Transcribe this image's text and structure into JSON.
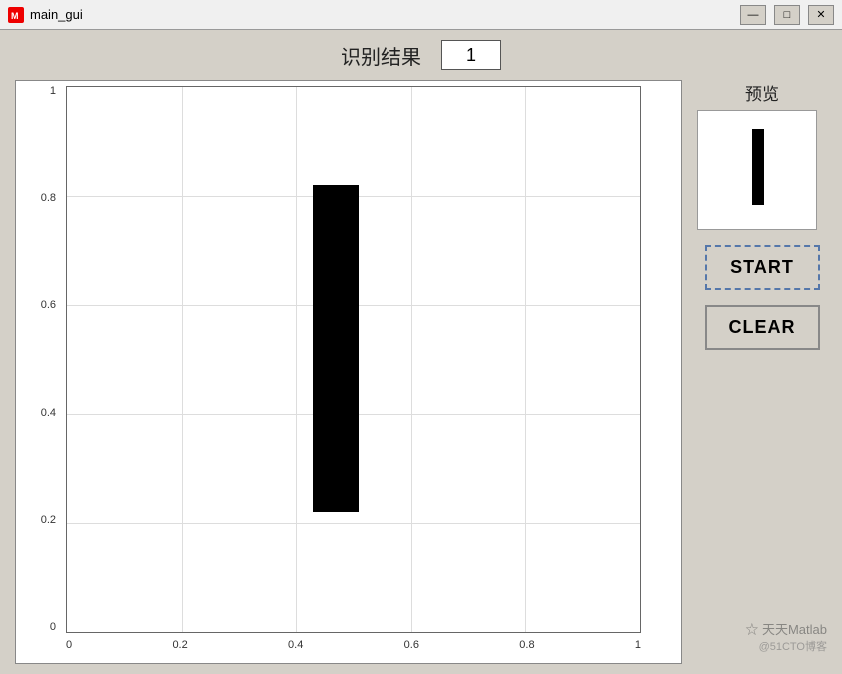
{
  "window": {
    "title": "main_gui",
    "icon_color": "#cc0000"
  },
  "titlebar": {
    "minimize_label": "—",
    "restore_label": "□",
    "close_label": "✕"
  },
  "header": {
    "result_label": "识别结果",
    "result_value": "1"
  },
  "plot": {
    "y_axis": [
      "1",
      "0.8",
      "0.6",
      "0.4",
      "0.2",
      "0"
    ],
    "x_axis": [
      "0",
      "0.2",
      "0.4",
      "0.6",
      "0.8",
      "1"
    ],
    "digit_rect": {
      "left_pct": 43,
      "top_pct": 18,
      "width_pct": 8,
      "height_pct": 60
    }
  },
  "preview": {
    "label": "预览",
    "digit_rect": {
      "left_pct": 46,
      "top_pct": 15,
      "width_pct": 10,
      "height_pct": 65
    }
  },
  "buttons": {
    "start_label": "START",
    "clear_label": "CLEAR"
  },
  "watermark": {
    "line1": "☆ 天天Matlab",
    "line2": "@51CTO博客"
  },
  "bottom_text": ""
}
